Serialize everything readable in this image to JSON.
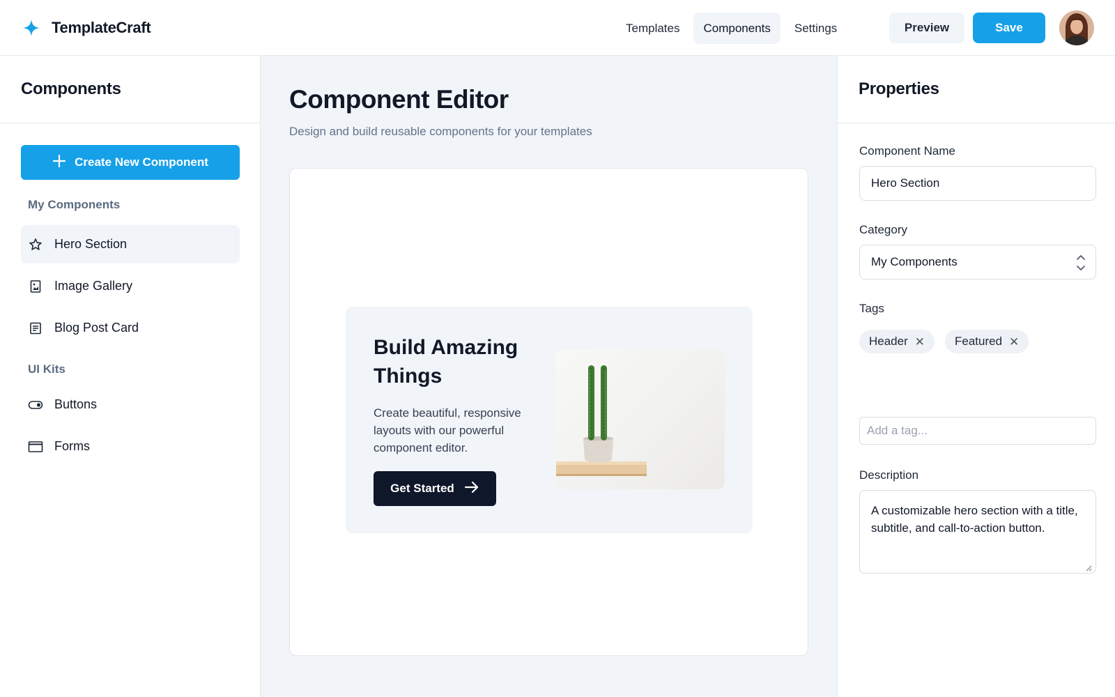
{
  "app": {
    "name": "TemplateCraft",
    "logo_icon": "sparkle-icon",
    "brand_color": "#16a0e8"
  },
  "nav": {
    "items": [
      {
        "label": "Templates",
        "active": false
      },
      {
        "label": "Components",
        "active": true
      },
      {
        "label": "Settings",
        "active": false
      }
    ],
    "preview_label": "Preview",
    "save_label": "Save"
  },
  "sidebar": {
    "title": "Components",
    "create_label": "Create New Component",
    "sections": [
      {
        "label": "My Components",
        "items": [
          {
            "label": "Hero Section",
            "icon": "star-icon",
            "active": true
          },
          {
            "label": "Image Gallery",
            "icon": "image-icon",
            "active": false
          },
          {
            "label": "Blog Post Card",
            "icon": "document-icon",
            "active": false
          }
        ]
      },
      {
        "label": "UI Kits",
        "items": [
          {
            "label": "Buttons",
            "icon": "toggle-icon",
            "active": false
          },
          {
            "label": "Forms",
            "icon": "window-icon",
            "active": false
          }
        ]
      }
    ]
  },
  "main": {
    "title": "Component Editor",
    "subtitle": "Design and build reusable components for your templates",
    "hero": {
      "title": "Build Amazing Things",
      "subtitle": "Create beautiful, responsive layouts with our powerful component editor.",
      "cta_label": "Get Started"
    }
  },
  "properties": {
    "title": "Properties",
    "name_label": "Component Name",
    "name_value": "Hero Section",
    "category_label": "Category",
    "category_value": "My Components",
    "tags_label": "Tags",
    "tags": [
      "Header",
      "Featured"
    ],
    "tag_placeholder": "Add a tag...",
    "description_label": "Description",
    "description_value": "A customizable hero section with a title, subtitle, and call-to-action button."
  }
}
